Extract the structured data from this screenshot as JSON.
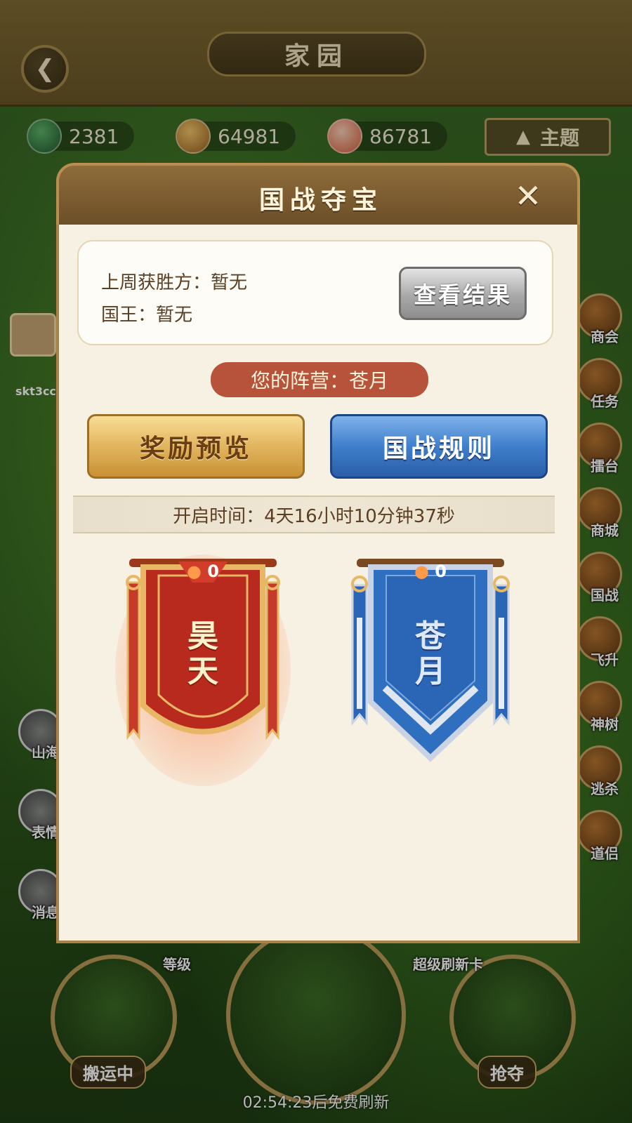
{
  "header": {
    "title": "家园",
    "back_icon": "back-arrow-icon"
  },
  "resources": [
    {
      "icon": "jade-icon",
      "value": "2381",
      "color": "#2f7a3a"
    },
    {
      "icon": "flower-icon",
      "value": "64981",
      "color": "#c98e35"
    },
    {
      "icon": "peach-icon",
      "value": "86781",
      "color": "#e58a6c"
    }
  ],
  "theme_button": {
    "label": "主题",
    "icon": "mountain-icon"
  },
  "right_menu": [
    "商会",
    "任务",
    "擂台",
    "商城",
    "国战",
    "飞升",
    "神树",
    "逃杀",
    "道侣"
  ],
  "left_menu": [
    "山海",
    "表情",
    "消息"
  ],
  "player": {
    "name": "skt3cc"
  },
  "bottom": {
    "left_label": "搬运中",
    "right_label": "抢夺",
    "mid_left_label": "等级",
    "mid_right_label": "超级刷新卡",
    "refresh_text": "02:54:23后免费刷新"
  },
  "dialog": {
    "title": "国战夺宝",
    "close_icon": "close-icon",
    "last_winner": "上周获胜方：暂无",
    "king": "国王：暂无",
    "view_result_label": "查看结果",
    "camp": "您的阵营：苍月",
    "reward_preview_label": "奖励预览",
    "rules_label": "国战规则",
    "open_time": "开启时间：4天16小时10分钟37秒",
    "factions": [
      {
        "name": "昊天",
        "score": "0",
        "color": "#c0392b",
        "icon": "flame-icon"
      },
      {
        "name": "苍月",
        "score": "0",
        "color": "#2f6fbf",
        "icon": "flame-icon"
      }
    ]
  }
}
